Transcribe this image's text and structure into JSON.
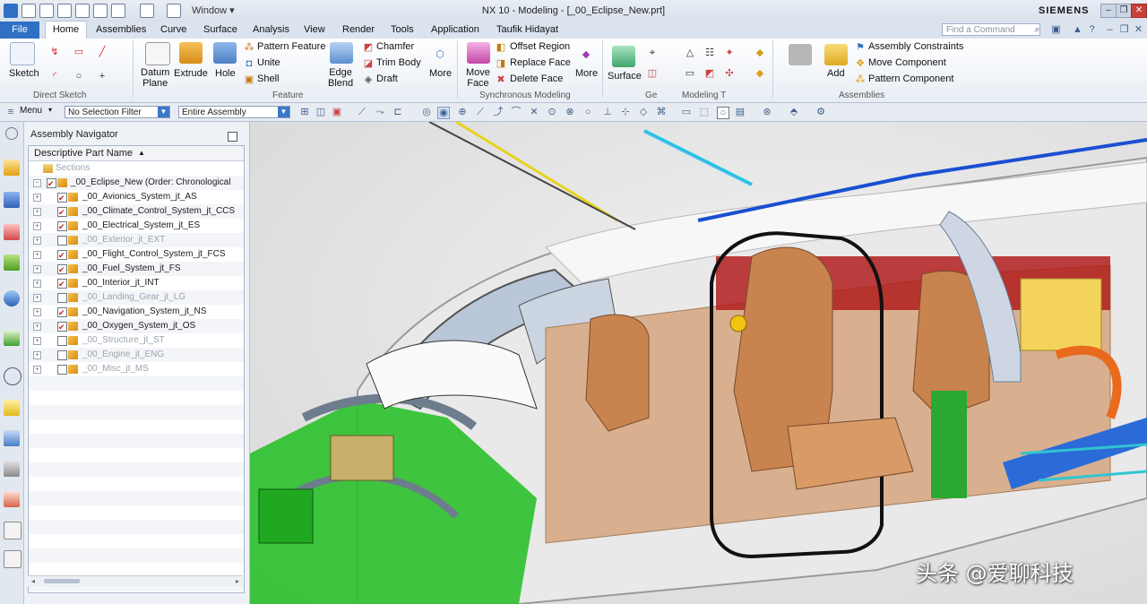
{
  "titlebar": {
    "window_menu": "Window ▾",
    "title": "NX 10 - Modeling - [_00_Eclipse_New.prt]",
    "brand": "SIEMENS"
  },
  "tabs": [
    "File",
    "Home",
    "Assemblies",
    "Curve",
    "Surface",
    "Analysis",
    "View",
    "Render",
    "Tools",
    "Application",
    "Taufik Hidayat"
  ],
  "find_command_placeholder": "Find a Command",
  "ribbon": {
    "sketch": "Sketch",
    "direct_sketch": "Direct Sketch",
    "datum_plane": "Datum\nPlane",
    "extrude": "Extrude",
    "hole": "Hole",
    "pattern_feature": "Pattern Feature",
    "unite": "Unite",
    "shell": "Shell",
    "edge_blend": "Edge\nBlend",
    "chamfer": "Chamfer",
    "trim_body": "Trim Body",
    "draft": "Draft",
    "more1": "More",
    "feature": "Feature",
    "move_face": "Move\nFace",
    "offset_region": "Offset Region",
    "replace_face": "Replace Face",
    "delete_face": "Delete Face",
    "more2": "More",
    "synchronous_modeling": "Synchronous Modeling",
    "surface": "Surface",
    "ge": "Ge",
    "modeling_t": "Modeling T",
    "add": "Add",
    "assembly_constraints": "Assembly Constraints",
    "move_component": "Move Component",
    "pattern_component": "Pattern Component",
    "assemblies": "Assemblies"
  },
  "selbar": {
    "menu": "Menu",
    "filter": "No Selection Filter",
    "scope": "Entire Assembly"
  },
  "navigator": {
    "title": "Assembly Navigator",
    "column": "Descriptive Part Name",
    "rows": [
      {
        "text": "Sections",
        "checked": null,
        "dim": true,
        "level": 1
      },
      {
        "text": "_00_Eclipse_New (Order: Chronological",
        "checked": true,
        "dim": false,
        "level": 0
      },
      {
        "text": "_00_Avionics_System_jt_AS",
        "checked": true,
        "dim": false,
        "level": 1
      },
      {
        "text": "_00_Climate_Control_System_jt_CCS",
        "checked": true,
        "dim": false,
        "level": 1
      },
      {
        "text": "_00_Electrical_System_jt_ES",
        "checked": true,
        "dim": false,
        "level": 1
      },
      {
        "text": "_00_Exterior_jt_EXT",
        "checked": false,
        "dim": true,
        "level": 1
      },
      {
        "text": "_00_Flight_Control_System_jt_FCS",
        "checked": true,
        "dim": false,
        "level": 1
      },
      {
        "text": "_00_Fuel_System_jt_FS",
        "checked": true,
        "dim": false,
        "level": 1
      },
      {
        "text": "_00_Interior_jt_INT",
        "checked": true,
        "dim": false,
        "level": 1
      },
      {
        "text": "_00_Landing_Gear_jt_LG",
        "checked": false,
        "dim": true,
        "level": 1
      },
      {
        "text": "_00_Navigation_System_jt_NS",
        "checked": true,
        "dim": false,
        "level": 1
      },
      {
        "text": "_00_Oxygen_System_jt_OS",
        "checked": true,
        "dim": false,
        "level": 1
      },
      {
        "text": "_00_Structure_jt_ST",
        "checked": false,
        "dim": true,
        "level": 1
      },
      {
        "text": "_00_Engine_jt_ENG",
        "checked": false,
        "dim": true,
        "level": 1
      },
      {
        "text": "_00_Misc_jt_MS",
        "checked": false,
        "dim": true,
        "level": 1
      }
    ]
  },
  "watermark": "头条 @爱聊科技"
}
